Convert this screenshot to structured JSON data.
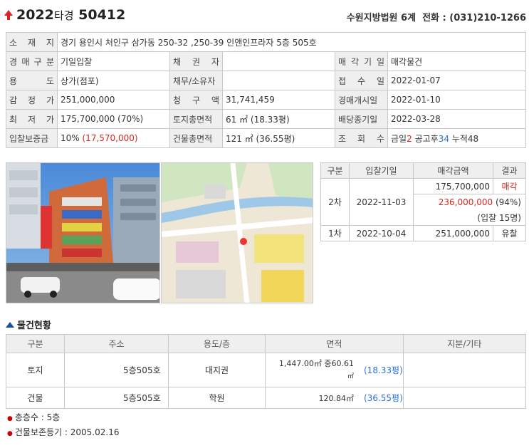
{
  "header": {
    "case_year": "2022",
    "case_type": "타경",
    "case_number": "50412",
    "court": "수원지방법원 6계",
    "phone_label": "전화 : ",
    "phone": "(031)210-1266"
  },
  "info": {
    "location_label": "소 재 지",
    "location": "경기 용인시 처인구 삼가동 250-32 ,250-39 인앤인프라자 5층 505호",
    "auction_type_label": "경 매 구 분",
    "auction_type": "기일입찰",
    "creditor_label": "채 권 자",
    "creditor": "",
    "sale_date_label": "매 각 기 일",
    "sale_date": "매각물건",
    "use_label": "용 도",
    "use": "상가(점포)",
    "debtor_label": "채무/소유자",
    "debtor": "",
    "received_label": "접 수 일",
    "received": "2022-01-07",
    "appraisal_label": "감 정 가",
    "appraisal": "251,000,000",
    "claim_label": "청 구 액",
    "claim": "31,741,459",
    "start_label": "경매개시일",
    "start": "2022-01-10",
    "min_price_label": "최 저 가",
    "min_price": "175,700,000 (70%)",
    "land_area_label": "토지총면적",
    "land_area": "61 ㎡ (18.33평)",
    "dividend_label": "배당종기일",
    "dividend": "2022-03-28",
    "deposit_label": "입찰보증금",
    "deposit_pct": "10%",
    "deposit_amount": "(17,570,000)",
    "bldg_area_label": "건물총면적",
    "bldg_area": "121 ㎡ (36.55평)",
    "views_label": "조 회 수",
    "views_today_label": "금일",
    "views_today": "2",
    "views_public_label": "공고후",
    "views_public": "34",
    "views_total_label": "누적",
    "views_total": "48"
  },
  "bids": {
    "headers": [
      "구분",
      "입찰기일",
      "매각금액",
      "결과"
    ],
    "round2": {
      "label": "2차",
      "date": "2022-11-03",
      "min_price": "175,700,000",
      "result": "매각",
      "sold_price": "236,000,000",
      "sold_pct": "(94%)",
      "bidders": "(입찰 15명)"
    },
    "round1": {
      "label": "1차",
      "date": "2022-10-04",
      "price": "251,000,000",
      "result": "유찰"
    }
  },
  "property": {
    "title": "물건현황",
    "headers": [
      "구분",
      "주소",
      "용도/층",
      "면적",
      "지분/기타"
    ],
    "rows": [
      {
        "type": "토지",
        "addr": "5층505호",
        "use": "대지권",
        "area_line1": "1,447.00㎡ 중60.61",
        "area_line2": "㎡",
        "pyeong": "(18.33평)",
        "etc": ""
      },
      {
        "type": "건물",
        "addr": "5층505호",
        "use": "학원",
        "area_line1": "120.84㎡",
        "area_line2": "",
        "pyeong": "(36.55평)",
        "etc": ""
      }
    ]
  },
  "notes": [
    "총층수 : 5층",
    "건물보존등기 : 2005.02.16"
  ],
  "colors": {
    "accent_red": "#d9251d",
    "accent_blue": "#2a6fd6",
    "label_bg": "#efefef",
    "border": "#c8c8c8"
  }
}
